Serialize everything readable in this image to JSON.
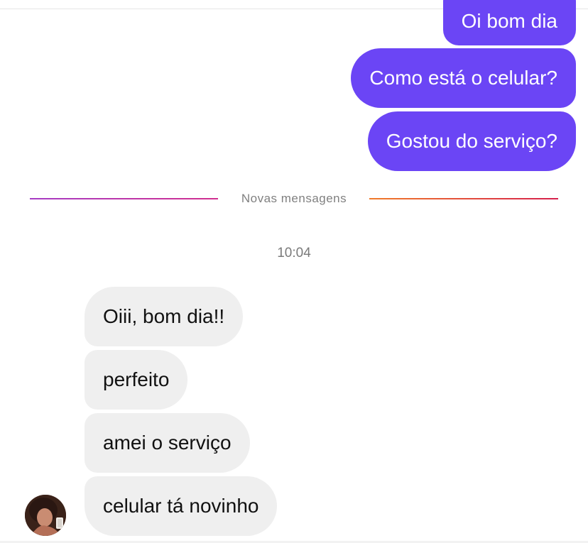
{
  "sent_messages": [
    {
      "text": "Oi bom dia"
    },
    {
      "text": "Como está o celular?"
    },
    {
      "text": "Gostou do serviço?"
    }
  ],
  "divider": {
    "label": "Novas mensagens"
  },
  "timestamp": "10:04",
  "received_messages": [
    {
      "text": "Oiii, bom dia!!"
    },
    {
      "text": "perfeito"
    },
    {
      "text": "amei o serviço"
    },
    {
      "text": "celular tá novinho"
    }
  ],
  "colors": {
    "sent_bubble": "#6b45f5",
    "received_bubble": "#efefef"
  }
}
